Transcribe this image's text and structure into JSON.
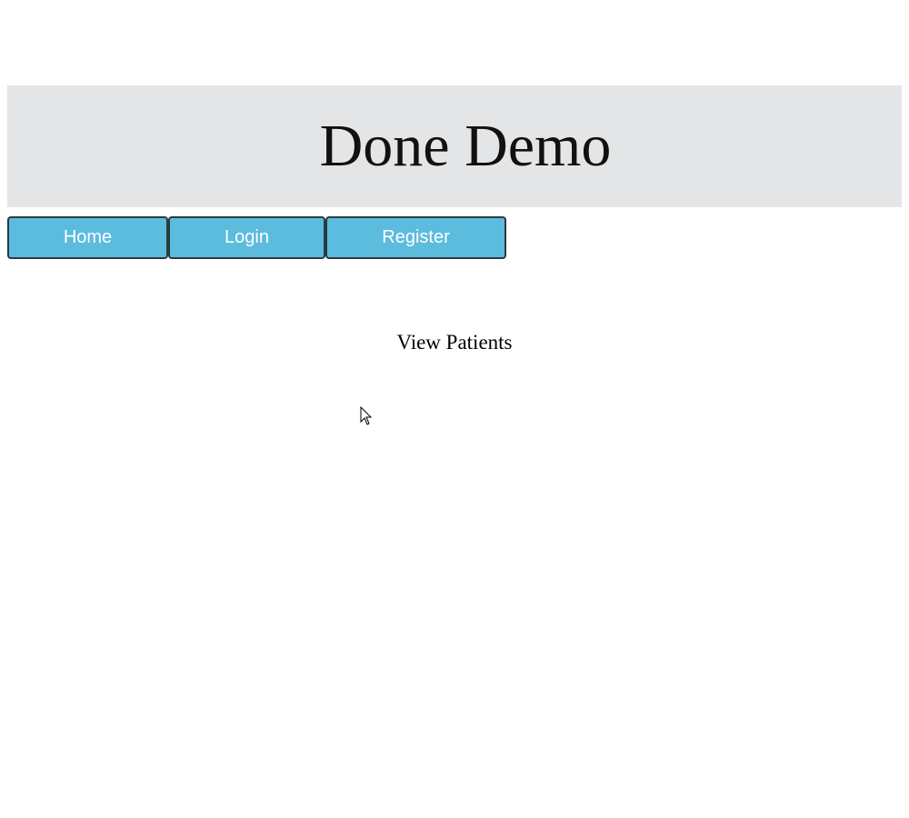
{
  "header": {
    "title": "Done Demo"
  },
  "nav": {
    "items": [
      {
        "label": "Home"
      },
      {
        "label": "Login"
      },
      {
        "label": "Register"
      }
    ],
    "button_color": "#5bbcdd"
  },
  "main": {
    "link_label": "View Patients"
  },
  "colors": {
    "header_bg": "#e4e5e7",
    "page_bg": "#ffffff"
  }
}
